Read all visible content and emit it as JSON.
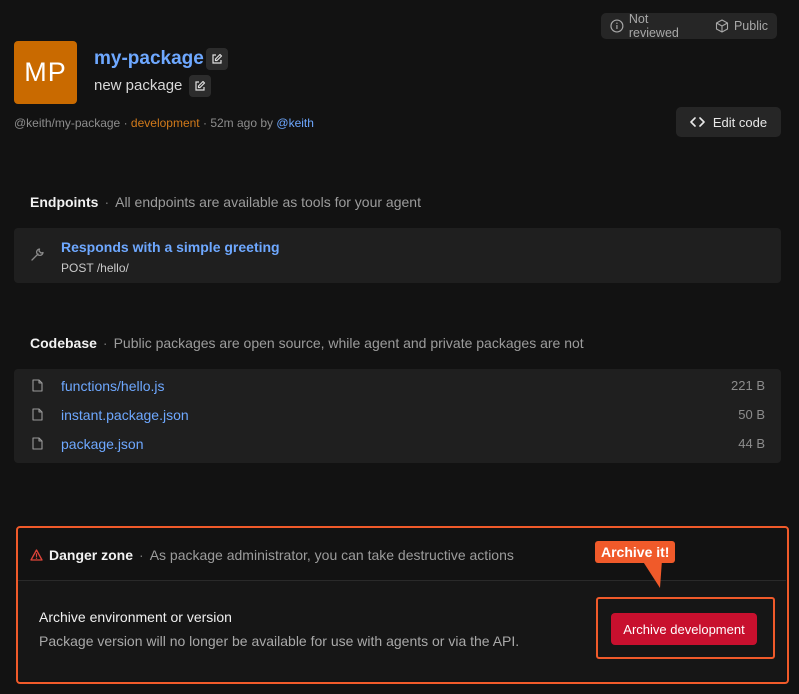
{
  "badges": {
    "review": "Not reviewed",
    "visibility": "Public"
  },
  "package": {
    "initials": "MP",
    "name": "my-package",
    "description": "new package",
    "path": "@keith/my-package",
    "environment": "development",
    "updated": "52m ago by",
    "author": "@keith",
    "edit_code_label": "Edit code"
  },
  "endpoints": {
    "title": "Endpoints",
    "subtitle": "All endpoints are available as tools for your agent",
    "items": [
      {
        "title": "Responds with a simple greeting",
        "method": "POST",
        "path": "/hello/"
      }
    ]
  },
  "codebase": {
    "title": "Codebase",
    "subtitle": "Public packages are open source, while agent and private packages are not",
    "files": [
      {
        "name": "functions/hello.js",
        "size": "221 B"
      },
      {
        "name": "instant.package.json",
        "size": "50 B"
      },
      {
        "name": "package.json",
        "size": "44 B"
      }
    ]
  },
  "danger_zone": {
    "title": "Danger zone",
    "subtitle": "As package administrator, you can take destructive actions",
    "action_title": "Archive environment or version",
    "action_desc": "Package version will no longer be available for use with agents or via the API.",
    "button_label": "Archive development",
    "callout": "Archive it!"
  },
  "colors": {
    "accent_link": "#6ea8ff",
    "logo_bg": "#c96a00",
    "env": "#d27a1a",
    "danger_button": "#c8102e",
    "annotation": "#f05a2a"
  }
}
